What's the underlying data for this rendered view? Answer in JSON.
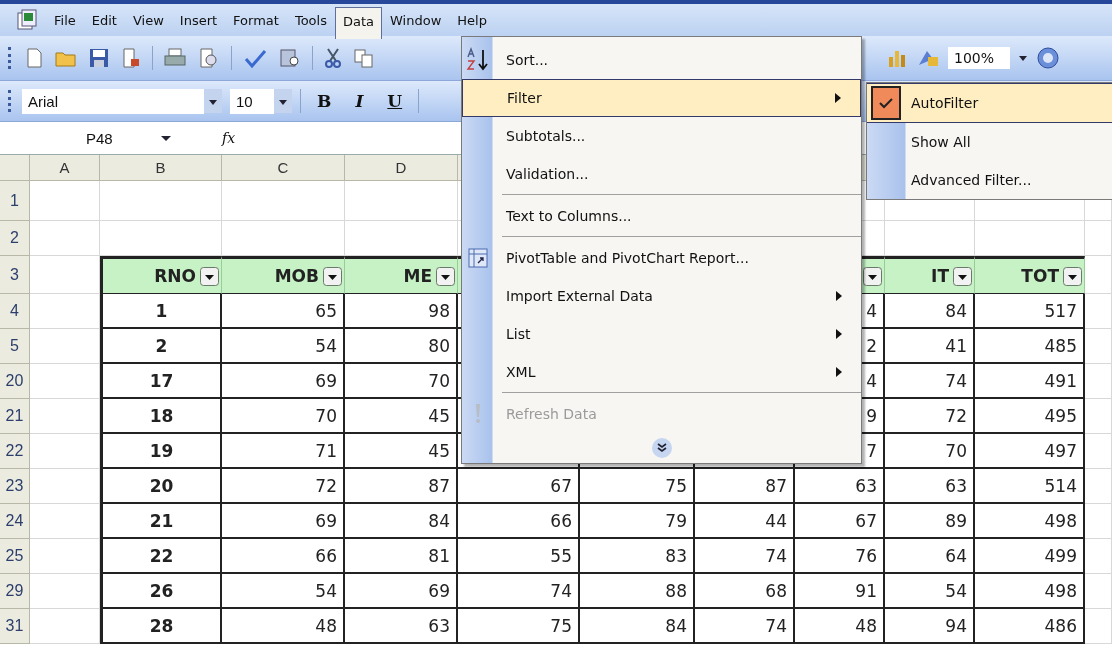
{
  "menu_bar": [
    {
      "label": "File",
      "selected": false
    },
    {
      "label": "Edit",
      "selected": false
    },
    {
      "label": "View",
      "selected": false
    },
    {
      "label": "Insert",
      "selected": false
    },
    {
      "label": "Format",
      "selected": false
    },
    {
      "label": "Tools",
      "selected": false
    },
    {
      "label": "Data",
      "selected": true
    },
    {
      "label": "Window",
      "selected": false
    },
    {
      "label": "Help",
      "selected": false
    }
  ],
  "toolbar": {
    "zoom": "100%"
  },
  "formatting_bar": {
    "font": "Arial",
    "size": "10",
    "buttons": [
      "B",
      "I",
      "U"
    ]
  },
  "formula_bar": {
    "name_box": "P48",
    "function_label": "fx"
  },
  "sheet": {
    "column_headers": [
      "A",
      "B",
      "C",
      "D"
    ],
    "header_row": {
      "num": "3",
      "cells": [
        {
          "label": "RNO",
          "filter": true
        },
        {
          "label": "MOB",
          "filter": true
        },
        {
          "label": "ME",
          "filter": true
        },
        null,
        null,
        null,
        {
          "filter": true
        },
        {
          "label": "IT",
          "filter": true
        },
        {
          "label": "TOT",
          "filter": true
        }
      ]
    },
    "blank_rows": [
      "1",
      "2"
    ],
    "rows": [
      {
        "num": "4",
        "cells": [
          "1",
          "65",
          "98",
          null,
          null,
          null,
          "4",
          "84",
          "517"
        ]
      },
      {
        "num": "5",
        "cells": [
          "2",
          "54",
          "80",
          null,
          null,
          null,
          "2",
          "41",
          "485"
        ]
      },
      {
        "num": "20",
        "cells": [
          "17",
          "69",
          "70",
          null,
          null,
          null,
          "4",
          "74",
          "491"
        ]
      },
      {
        "num": "21",
        "cells": [
          "18",
          "70",
          "45",
          null,
          null,
          null,
          "9",
          "72",
          "495"
        ]
      },
      {
        "num": "22",
        "cells": [
          "19",
          "71",
          "45",
          null,
          null,
          null,
          "7",
          "70",
          "497"
        ]
      },
      {
        "num": "23",
        "cells": [
          "20",
          "72",
          "87",
          "67",
          "75",
          "87",
          "63",
          "63",
          "514"
        ]
      },
      {
        "num": "24",
        "cells": [
          "21",
          "69",
          "84",
          "66",
          "79",
          "44",
          "67",
          "89",
          "498"
        ]
      },
      {
        "num": "25",
        "cells": [
          "22",
          "66",
          "81",
          "55",
          "83",
          "74",
          "76",
          "64",
          "499"
        ]
      },
      {
        "num": "29",
        "cells": [
          "26",
          "54",
          "69",
          "74",
          "88",
          "68",
          "91",
          "54",
          "498"
        ]
      },
      {
        "num": "31",
        "cells": [
          "28",
          "48",
          "63",
          "75",
          "84",
          "74",
          "48",
          "94",
          "486"
        ]
      }
    ]
  },
  "data_menu": {
    "items": [
      {
        "label": "Sort...",
        "submenu": false,
        "selected": false,
        "disabled": false,
        "divider_above": false
      },
      {
        "label": "Filter",
        "submenu": true,
        "selected": true,
        "disabled": false,
        "divider_above": false
      },
      {
        "label": "Subtotals...",
        "submenu": false,
        "selected": false,
        "disabled": false,
        "divider_above": false
      },
      {
        "label": "Validation...",
        "submenu": false,
        "selected": false,
        "disabled": false,
        "divider_above": false
      },
      {
        "label": "Text to Columns...",
        "submenu": false,
        "selected": false,
        "disabled": false,
        "divider_above": true
      },
      {
        "label": "PivotTable and PivotChart Report...",
        "submenu": false,
        "selected": false,
        "disabled": false,
        "divider_above": true
      },
      {
        "label": "Import External Data",
        "submenu": true,
        "selected": false,
        "disabled": false,
        "divider_above": false
      },
      {
        "label": "List",
        "submenu": true,
        "selected": false,
        "disabled": false,
        "divider_above": false
      },
      {
        "label": "XML",
        "submenu": true,
        "selected": false,
        "disabled": false,
        "divider_above": false
      },
      {
        "label": "Refresh Data",
        "submenu": false,
        "selected": false,
        "disabled": true,
        "divider_above": true
      }
    ]
  },
  "filter_submenu": {
    "items": [
      {
        "label": "AutoFilter",
        "checked": true,
        "selected": true
      },
      {
        "label": "Show All",
        "checked": false,
        "selected": false
      },
      {
        "label": "Advanced Filter...",
        "checked": false,
        "selected": false
      }
    ]
  }
}
